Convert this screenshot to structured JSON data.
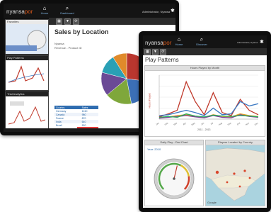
{
  "tablet_back": {
    "logo_main": "nyansa",
    "logo_accent": "por",
    "nav_home": "Home",
    "nav_dashboard": "Dashboard",
    "user_label": "Administrator, Nyansa",
    "page_title": "Sales by Location",
    "side_items": [
      {
        "label": "Favorites"
      },
      {
        "label": "Play Patterns"
      },
      {
        "label": "Trial Analytics"
      }
    ],
    "detail_line1": "Nyansa",
    "detail_line2": "Revenue - Product ID",
    "table_header": [
      "Country",
      "Sales"
    ],
    "table_rows": [
      [
        "Germany",
        "1240"
      ],
      [
        "Canada",
        "980"
      ],
      [
        "France",
        "870"
      ],
      [
        "India",
        "640"
      ],
      [
        "Brazil",
        "520"
      ]
    ],
    "pie": {
      "slices": [
        {
          "value": 27,
          "color": "#b9362e"
        },
        {
          "value": 20,
          "color": "#3b6fb6"
        },
        {
          "value": 17,
          "color": "#7fa73b"
        },
        {
          "value": 15,
          "color": "#6b4a96"
        },
        {
          "value": 12,
          "color": "#2aa0b5"
        },
        {
          "value": 9,
          "color": "#e08a2b"
        }
      ]
    }
  },
  "tablet_front": {
    "logo_main": "nyansa",
    "logo_accent": "por",
    "nav_home": "Home",
    "nav_discover": "Discover",
    "user_label": "Administrator, Nyansa",
    "page_title": "Play Patterns",
    "chart_header": "Hours Played by Month",
    "ylabel": "Hours Played",
    "xlabel": "2011 - 2013",
    "gauge_header": "Daily Play - Dial Chart",
    "gauge_value_label": "Year: 2010",
    "map_header": "Players Located by Country",
    "map_attribution": "Google"
  },
  "line_chart": {
    "type": "line",
    "categories": [
      "Jan",
      "Feb",
      "Mar",
      "Apr",
      "May",
      "Jun",
      "Jul",
      "Aug",
      "Sep",
      "Oct",
      "Nov",
      "Dec"
    ],
    "series": [
      {
        "color": "#c0392b",
        "values": [
          5,
          12,
          20,
          85,
          40,
          10,
          60,
          15,
          8,
          45,
          20,
          10
        ]
      },
      {
        "color": "#3a78c2",
        "values": [
          8,
          10,
          15,
          20,
          15,
          8,
          25,
          10,
          12,
          40,
          30,
          35
        ]
      },
      {
        "color": "#e0a020",
        "values": [
          3,
          5,
          8,
          10,
          6,
          4,
          10,
          6,
          5,
          12,
          8,
          6
        ]
      },
      {
        "color": "#7d3c98",
        "values": [
          2,
          4,
          6,
          8,
          5,
          3,
          8,
          4,
          3,
          10,
          6,
          4
        ]
      },
      {
        "color": "#27ae60",
        "values": [
          4,
          6,
          4,
          12,
          7,
          5,
          9,
          7,
          6,
          8,
          7,
          5
        ]
      }
    ],
    "ylim": [
      0,
      100
    ]
  },
  "gauge": {
    "value_fraction": 0.55
  },
  "colors": {
    "accent": "#e05a1a",
    "appbar": "#141414",
    "sales_bar": "#e23b3b"
  }
}
